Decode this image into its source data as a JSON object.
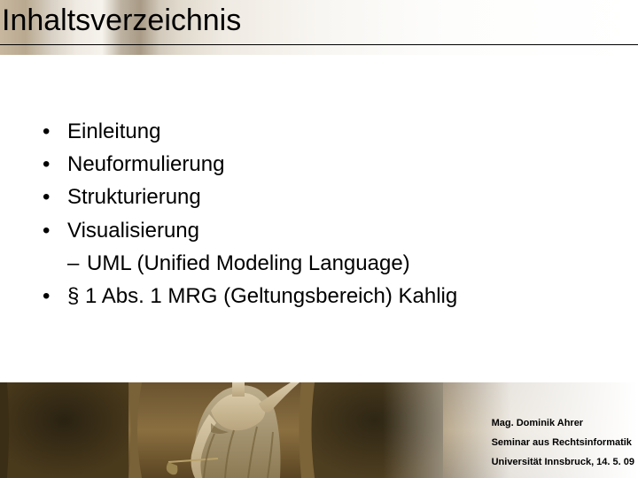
{
  "title": "Inhaltsverzeichnis",
  "bullets": {
    "b0": "Einleitung",
    "b1": "Neuformulierung",
    "b2": "Strukturierung",
    "b3": "Visualisierung",
    "b3_sub0": "UML (Unified Modeling Language)",
    "b4": "§ 1 Abs. 1 MRG (Geltungsbereich) Kahlig"
  },
  "footer": {
    "author": "Mag. Dominik Ahrer",
    "course": "Seminar aus Rechtsinformatik",
    "place_date": "Universität Innsbruck, 14. 5. 09"
  }
}
